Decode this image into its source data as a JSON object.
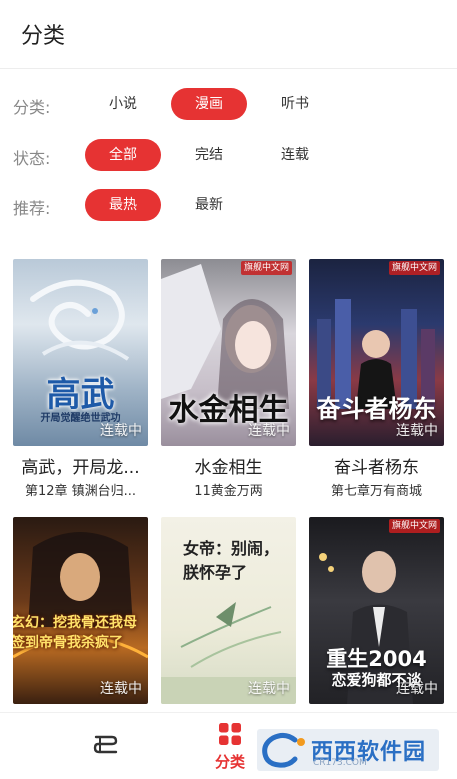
{
  "header": {
    "title": "分类"
  },
  "filters": {
    "category": {
      "label": "分类:",
      "options": [
        "小说",
        "漫画",
        "听书"
      ],
      "selected": "漫画"
    },
    "status": {
      "label": "状态:",
      "options": [
        "全部",
        "完结",
        "连载"
      ],
      "selected": "全部"
    },
    "recommend": {
      "label": "推荐:",
      "options": [
        "最热",
        "最新"
      ],
      "selected": "最热"
    }
  },
  "books": [
    {
      "name": "高武，开局龙...",
      "chapter": "第12章 镇渊台归...",
      "status": "连载中",
      "cover_title": "高武",
      "cover_subtitle": "开局觉醒绝世武功"
    },
    {
      "name": "水金相生",
      "chapter": "11黄金万两",
      "status": "连载中",
      "cover_title": "水金相生",
      "cover_badge": "旗舰中文网"
    },
    {
      "name": "奋斗者杨东",
      "chapter": "第七章万有商城",
      "status": "连载中",
      "cover_title": "奋斗者杨东",
      "cover_badge": "旗舰中文网"
    },
    {
      "name": "",
      "chapter": "",
      "status": "连载中",
      "cover_title": "玄幻：挖我骨还我母 签到帝骨我杀疯了"
    },
    {
      "name": "",
      "chapter": "",
      "status": "连载中",
      "cover_title": "女帝：别闹，朕怀孕了"
    },
    {
      "name": "",
      "chapter": "",
      "status": "连载中",
      "cover_title": "重生2004",
      "cover_subtitle": "恋爱狗都不谈",
      "cover_badge": "旗舰中文网"
    }
  ],
  "tabbar": {
    "tabs": [
      {
        "label": "",
        "icon": "bookshelf-icon",
        "active": false
      },
      {
        "label": "分类",
        "icon": "category-grid-icon",
        "active": true
      }
    ],
    "active_color": "#e63333"
  },
  "watermark": {
    "text": "西西软件园",
    "url": "CR173.COM"
  },
  "colors": {
    "accent": "#e63333",
    "label_gray": "#888888"
  }
}
